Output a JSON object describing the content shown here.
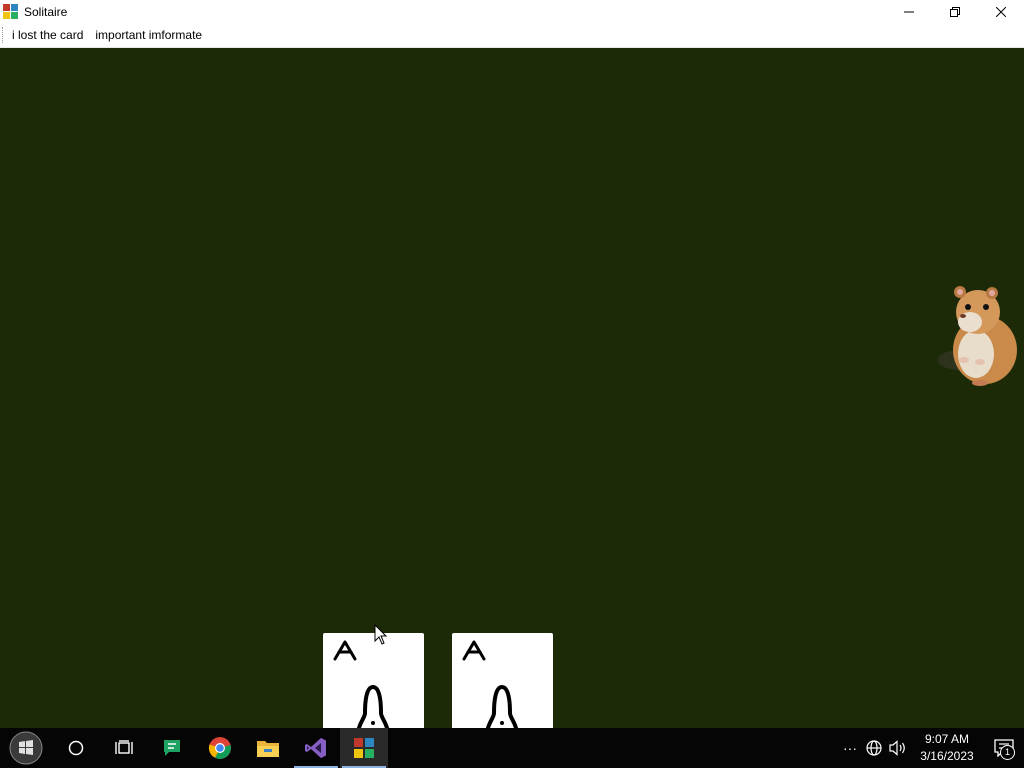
{
  "window": {
    "title": "Solitaire",
    "controls": {
      "minimize": "—",
      "maximize": "❐",
      "close": "✕"
    }
  },
  "menu": {
    "items": [
      {
        "label": "i lost the card"
      },
      {
        "label": "important imformate"
      }
    ]
  },
  "cards": [
    {
      "rank": "A",
      "suit": "club-icon"
    },
    {
      "rank": "A",
      "suit": "club-icon"
    }
  ],
  "taskbar": {
    "apps": [
      "start-icon",
      "search-icon",
      "task-view-icon",
      "messages-icon",
      "chrome-icon",
      "file-explorer-icon",
      "visual-studio-icon",
      "solitaire-app-icon"
    ],
    "tray": {
      "overflow": "···",
      "time": "9:07 AM",
      "date": "3/16/2023",
      "notification_count": "1"
    }
  },
  "colors": {
    "felt": "#1c2a07",
    "taskbar": "#050505",
    "card": "#ffffff"
  }
}
